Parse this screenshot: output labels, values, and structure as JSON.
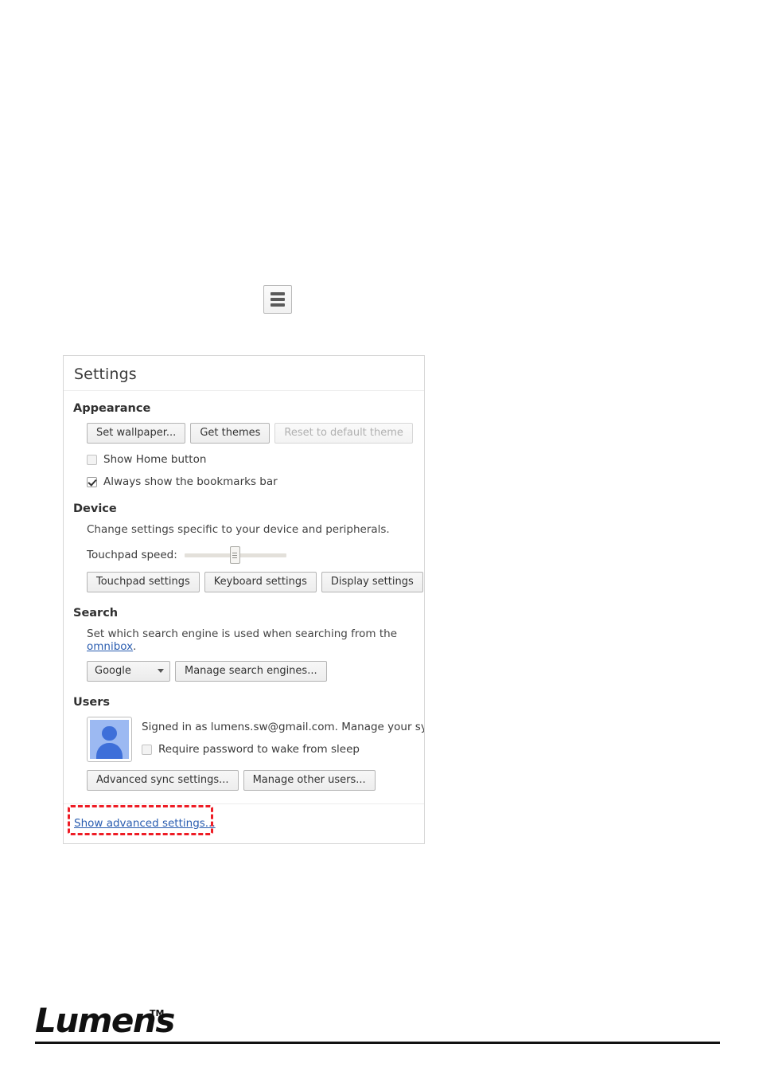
{
  "menu_button": {
    "icon": "hamburger-menu-icon",
    "bars": 3
  },
  "settings_panel": {
    "title": "Settings",
    "sections": {
      "appearance": {
        "title": "Appearance",
        "buttons": [
          {
            "label": "Set wallpaper...",
            "disabled": false
          },
          {
            "label": "Get themes",
            "disabled": false
          },
          {
            "label": "Reset to default theme",
            "disabled": true
          }
        ],
        "checkboxes": [
          {
            "label": "Show Home button",
            "checked": false
          },
          {
            "label": "Always show the bookmarks bar",
            "checked": true
          }
        ]
      },
      "device": {
        "title": "Device",
        "description": "Change settings specific to your device and peripherals.",
        "slider_label": "Touchpad speed:",
        "slider_value_percent": 45,
        "buttons": [
          {
            "label": "Touchpad settings",
            "disabled": false
          },
          {
            "label": "Keyboard settings",
            "disabled": false
          },
          {
            "label": "Display settings",
            "disabled": false
          }
        ]
      },
      "search": {
        "title": "Search",
        "description_before": "Set which search engine is used when searching from the ",
        "description_link": "omnibox",
        "description_after": ".",
        "selected_engine": "Google",
        "manage_button": "Manage search engines..."
      },
      "users": {
        "title": "Users",
        "signed_in_text": "Signed in as lumens.sw@gmail.com. Manage your synced data",
        "checkbox": {
          "label": "Require password to wake from sleep",
          "checked": false
        },
        "buttons": [
          {
            "label": "Advanced sync settings...",
            "disabled": false
          },
          {
            "label": "Manage other users...",
            "disabled": false
          }
        ]
      }
    },
    "footer_link": "Show advanced settings..."
  },
  "highlight": {
    "color": "#ee1c25",
    "target": "Show advanced settings..."
  },
  "page_footer": {
    "logo_text": "Lumens",
    "trademark": "TM"
  }
}
